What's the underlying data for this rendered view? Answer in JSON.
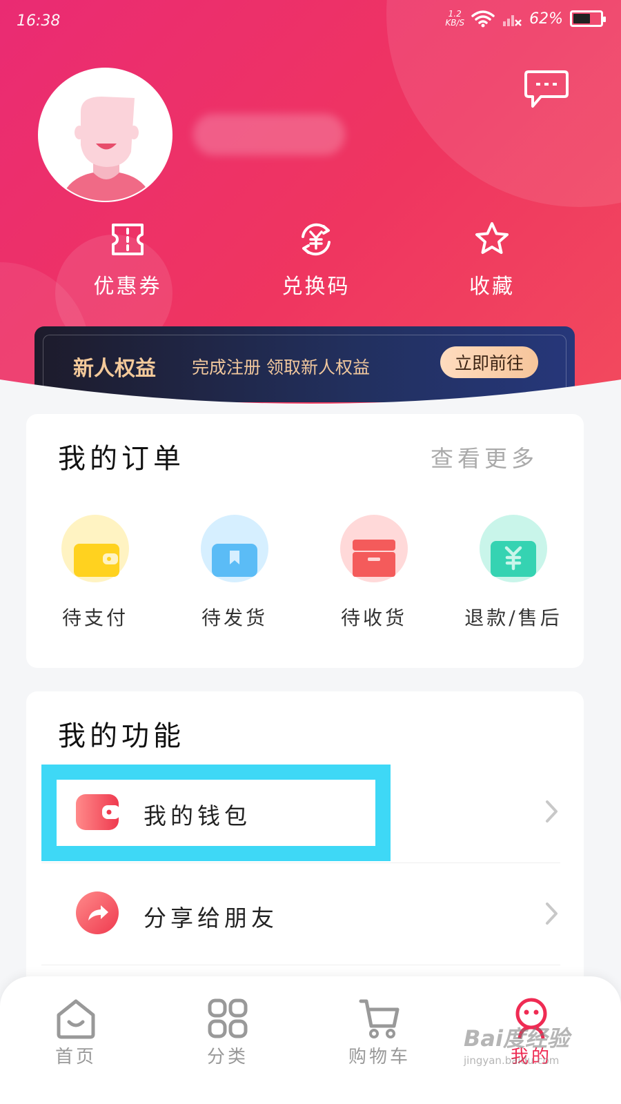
{
  "status_bar": {
    "time": "16:38",
    "net_speed_value": "1.2",
    "net_speed_unit": "KB/S",
    "battery": "62%",
    "battery_level": 0.62
  },
  "header": {
    "quick_actions": [
      {
        "label": "优惠券",
        "icon": "ticket-icon"
      },
      {
        "label": "兑换码",
        "icon": "yuan-exchange-icon"
      },
      {
        "label": "收藏",
        "icon": "star-icon"
      }
    ]
  },
  "promo": {
    "title": "新人权益",
    "subtitle": "完成注册 领取新人权益",
    "button": "立即前往"
  },
  "orders": {
    "title": "我的订单",
    "more": "查看更多",
    "items": [
      {
        "label": "待支付",
        "icon": "wallet-icon",
        "color": "#ffd21f"
      },
      {
        "label": "待发货",
        "icon": "bookmark-box-icon",
        "color": "#5bbcf6"
      },
      {
        "label": "待收货",
        "icon": "package-icon",
        "color": "#f45b5b"
      },
      {
        "label": "退款/售后",
        "icon": "yuan-card-icon",
        "color": "#35d3b2"
      }
    ]
  },
  "functions": {
    "title": "我的功能",
    "items": [
      {
        "label": "我的钱包",
        "icon": "wallet-icon"
      },
      {
        "label": "分享给朋友",
        "icon": "share-icon"
      }
    ]
  },
  "tabbar": {
    "items": [
      {
        "label": "首页",
        "icon": "home-icon"
      },
      {
        "label": "分类",
        "icon": "category-grid-icon"
      },
      {
        "label": "购物车",
        "icon": "cart-icon"
      },
      {
        "label": "我的",
        "icon": "profile-face-icon"
      }
    ],
    "active_index": 3
  },
  "watermark": {
    "logo": "Bai度经验",
    "url": "jingyan.baidu.com"
  },
  "colors": {
    "brand": "#ef2b53",
    "highlight": "#3ed8f6",
    "promo_gold": "#f3c99a"
  }
}
